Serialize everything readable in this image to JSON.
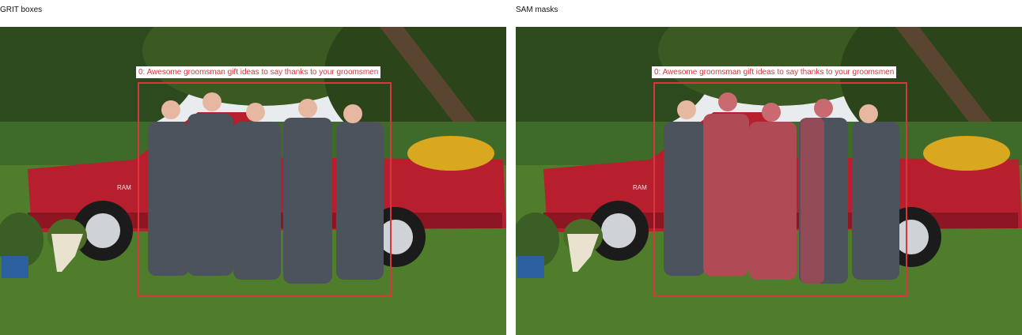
{
  "panels": [
    {
      "title": "GRIT boxes",
      "box_label": "0: Awesome groomsman gift ideas to say thanks to your groomsmen"
    },
    {
      "title": "SAM masks",
      "box_label": "0: Awesome groomsman gift ideas to say thanks to your groomsmen"
    }
  ],
  "truck_badge": "RAM",
  "colors": {
    "box": "#d9363e",
    "mask": "#c8555d",
    "truck": "#b81f2e",
    "grass": "#4f7d2c",
    "sky": "#e8ecef",
    "suit": "#4d535d"
  }
}
